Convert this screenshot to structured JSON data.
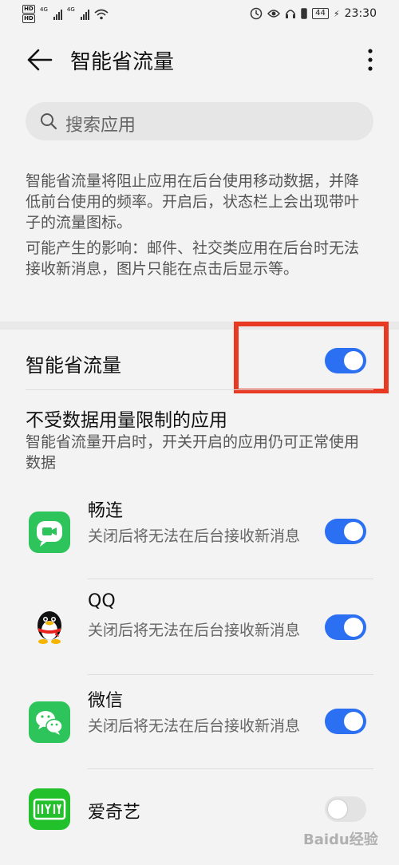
{
  "status_bar": {
    "hd1": "HD",
    "hd2": "HD",
    "net1": "4G",
    "net2": "4G",
    "battery": "44",
    "time": "23:30"
  },
  "header": {
    "title": "智能省流量"
  },
  "search": {
    "placeholder": "搜索应用"
  },
  "description": {
    "main": "智能省流量将阻止应用在后台使用移动数据，并降低前台使用的频率。开启后，状态栏上会出现带叶子的流量图标。",
    "impact": "可能产生的影响：邮件、社交类应用在后台时无法接收新消息，图片只能在点击后显示等。"
  },
  "main_toggle": {
    "label": "智能省流量",
    "on": true
  },
  "unrestricted": {
    "title": "不受数据用量限制的应用",
    "subtitle": "智能省流量开启时，开关开启的应用仍可正常使用数据"
  },
  "apps": [
    {
      "name": "畅连",
      "subtitle": "关闭后将无法在后台接收新消息",
      "on": true,
      "icon": "changlian-app-icon",
      "color": "#2ec45c"
    },
    {
      "name": "QQ",
      "subtitle": "关闭后将无法在后台接收新消息",
      "on": true,
      "icon": "qq-penguin-icon",
      "color": "#111111"
    },
    {
      "name": "微信",
      "subtitle": "关闭后将无法在后台接收新消息",
      "on": true,
      "icon": "wechat-app-icon",
      "color": "#2ec45c"
    },
    {
      "name": "爱奇艺",
      "subtitle": "",
      "on": false,
      "icon": "iqiyi-app-icon",
      "color": "#22c02a"
    }
  ],
  "colors": {
    "accent": "#2b6ff2",
    "highlight_box": "#e83a22"
  },
  "watermark": "Baidu经验"
}
